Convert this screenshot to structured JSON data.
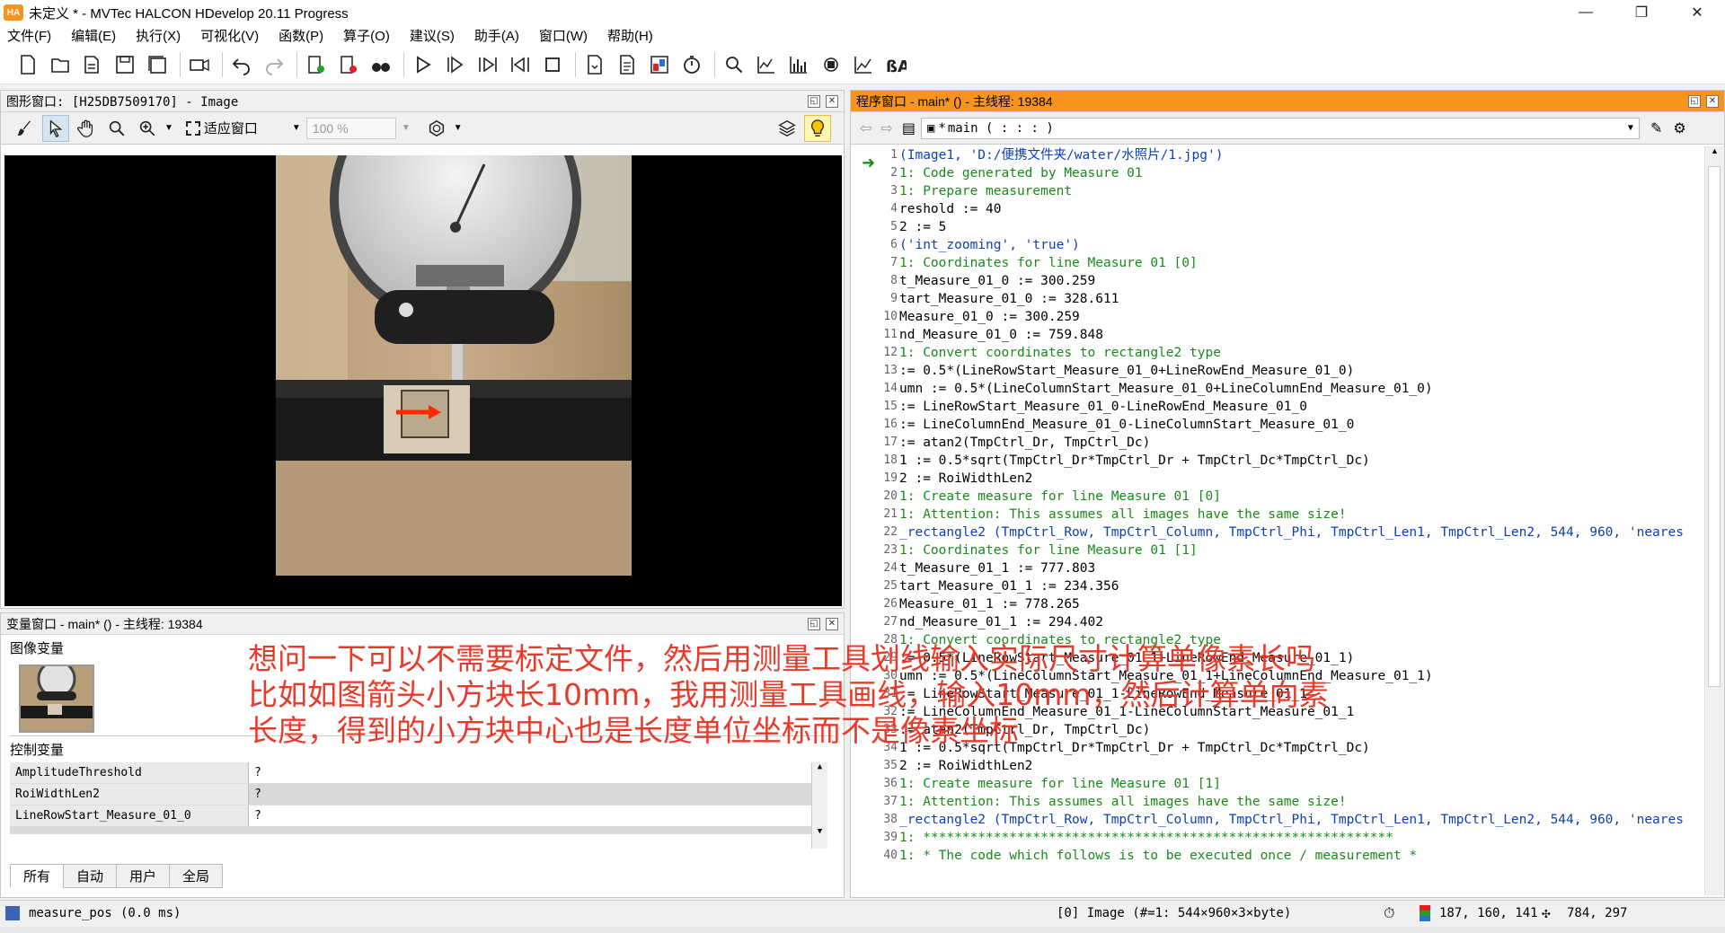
{
  "window": {
    "title": "未定义 * - MVTec HALCON HDevelop 20.11 Progress",
    "logo": "HA",
    "controls": [
      "—",
      "❐",
      "✕"
    ]
  },
  "menu": [
    "文件(F)",
    "编辑(E)",
    "执行(X)",
    "可视化(V)",
    "函数(P)",
    "算子(O)",
    "建议(S)",
    "助手(A)",
    "窗口(W)",
    "帮助(H)"
  ],
  "graphics_window": {
    "title": "图形窗口: [H25DB7509170] - Image",
    "fit_label": "适应窗口",
    "zoom_value": "100 %"
  },
  "variables_window": {
    "title": "变量窗口 - main* () - 主线程: 19384",
    "image_vars_label": "图像变量",
    "control_vars_label": "控制变量",
    "control_vars": [
      {
        "name": "AmplitudeThreshold",
        "value": "?"
      },
      {
        "name": "RoiWidthLen2",
        "value": "?"
      },
      {
        "name": "LineRowStart_Measure_01_0",
        "value": "?"
      }
    ],
    "tabs": [
      "所有",
      "自动",
      "用户",
      "全局"
    ]
  },
  "program_window": {
    "title": "程序窗口 - main* () - 主线程: 19384",
    "procedure": "main ( : : : )",
    "lines": [
      {
        "n": "1",
        "t": "(Image1, 'D:/便携文件夹/water/水照片/1.jpg')",
        "c": "kw"
      },
      {
        "n": "2",
        "t": "1: Code generated by Measure 01",
        "c": "cm"
      },
      {
        "n": "3",
        "t": "1: Prepare measurement",
        "c": "cm"
      },
      {
        "n": "4",
        "t": "reshold := 40",
        "c": ""
      },
      {
        "n": "5",
        "t": "2 := 5",
        "c": ""
      },
      {
        "n": "6",
        "t": "('int_zooming', 'true')",
        "c": "kw"
      },
      {
        "n": "7",
        "t": "1: Coordinates for line Measure 01 [0]",
        "c": "cm"
      },
      {
        "n": "8",
        "t": "t_Measure_01_0 := 300.259",
        "c": ""
      },
      {
        "n": "9",
        "t": "tart_Measure_01_0 := 328.611",
        "c": ""
      },
      {
        "n": "10",
        "t": "Measure_01_0 := 300.259",
        "c": ""
      },
      {
        "n": "11",
        "t": "nd_Measure_01_0 := 759.848",
        "c": ""
      },
      {
        "n": "12",
        "t": "1: Convert coordinates to rectangle2 type",
        "c": "cm"
      },
      {
        "n": "13",
        "t": " := 0.5*(LineRowStart_Measure_01_0+LineRowEnd_Measure_01_0)",
        "c": ""
      },
      {
        "n": "14",
        "t": "umn := 0.5*(LineColumnStart_Measure_01_0+LineColumnEnd_Measure_01_0)",
        "c": ""
      },
      {
        "n": "15",
        "t": ":= LineRowStart_Measure_01_0-LineRowEnd_Measure_01_0",
        "c": ""
      },
      {
        "n": "16",
        "t": ":= LineColumnEnd_Measure_01_0-LineColumnStart_Measure_01_0",
        "c": ""
      },
      {
        "n": "17",
        "t": " := atan2(TmpCtrl_Dr, TmpCtrl_Dc)",
        "c": ""
      },
      {
        "n": "18",
        "t": "1 := 0.5*sqrt(TmpCtrl_Dr*TmpCtrl_Dr + TmpCtrl_Dc*TmpCtrl_Dc)",
        "c": ""
      },
      {
        "n": "19",
        "t": "2 := RoiWidthLen2",
        "c": ""
      },
      {
        "n": "20",
        "t": "1: Create measure for line Measure 01 [0]",
        "c": "cm"
      },
      {
        "n": "21",
        "t": "1: Attention: This assumes all images have the same size!",
        "c": "cm"
      },
      {
        "n": "22",
        "t": "_rectangle2 (TmpCtrl_Row, TmpCtrl_Column, TmpCtrl_Phi, TmpCtrl_Len1, TmpCtrl_Len2, 544, 960, 'neares",
        "c": "kw"
      },
      {
        "n": "23",
        "t": "1: Coordinates for line Measure 01 [1]",
        "c": "cm"
      },
      {
        "n": "24",
        "t": "t_Measure_01_1 := 777.803",
        "c": ""
      },
      {
        "n": "25",
        "t": "tart_Measure_01_1 := 234.356",
        "c": ""
      },
      {
        "n": "26",
        "t": "Measure_01_1 := 778.265",
        "c": ""
      },
      {
        "n": "27",
        "t": "nd_Measure_01_1 := 294.402",
        "c": ""
      },
      {
        "n": "28",
        "t": "1: Convert coordinates to rectangle2 type",
        "c": "cm"
      },
      {
        "n": "29",
        "t": " := 0.5*(LineRowStart_Measure_01_1+LineRowEnd_Measure_01_1)",
        "c": ""
      },
      {
        "n": "30",
        "t": "umn := 0.5*(LineColumnStart_Measure_01_1+LineColumnEnd_Measure_01_1)",
        "c": ""
      },
      {
        "n": "31",
        "t": ":= LineRowStart_Measure_01_1-LineRowEnd_Measure_01_1",
        "c": ""
      },
      {
        "n": "32",
        "t": ":= LineColumnEnd_Measure_01_1-LineColumnStart_Measure_01_1",
        "c": ""
      },
      {
        "n": "33",
        "t": " := atan2(TmpCtrl_Dr, TmpCtrl_Dc)",
        "c": ""
      },
      {
        "n": "34",
        "t": "1 := 0.5*sqrt(TmpCtrl_Dr*TmpCtrl_Dr + TmpCtrl_Dc*TmpCtrl_Dc)",
        "c": ""
      },
      {
        "n": "35",
        "t": "2 := RoiWidthLen2",
        "c": ""
      },
      {
        "n": "36",
        "t": "1: Create measure for line Measure 01 [1]",
        "c": "cm"
      },
      {
        "n": "37",
        "t": "1: Attention: This assumes all images have the same size!",
        "c": "cm"
      },
      {
        "n": "38",
        "t": "_rectangle2 (TmpCtrl_Row, TmpCtrl_Column, TmpCtrl_Phi, TmpCtrl_Len1, TmpCtrl_Len2, 544, 960, 'neares",
        "c": "kw"
      },
      {
        "n": "39",
        "t": "1: ************************************************************",
        "c": "cm"
      },
      {
        "n": "40",
        "t": "1: * The code which follows is to be executed once / measurement *",
        "c": "cm"
      }
    ]
  },
  "annotation": {
    "line1": "想问一下可以不需要标定文件，然后用测量工具划线输入实际尺寸计算单像素长吗",
    "line2": "比如如图箭头小方块长10mm，我用测量工具画线，输入10mm，然后计算单向素",
    "line3": "长度，得到的小方块中心也是长度单位坐标而不是像素坐标"
  },
  "status": {
    "operator": "measure_pos",
    "time": "(0.0 ms)",
    "image_info": "[0] Image (#=1: 544×960×3×byte)",
    "rgb": "187, 160, 141",
    "coords": "784, 297"
  },
  "colors": {
    "program_header": "#f7941d",
    "annotation": "#e83a2a",
    "comment": "#1a8a1a",
    "operator": "#0b3fbf"
  }
}
